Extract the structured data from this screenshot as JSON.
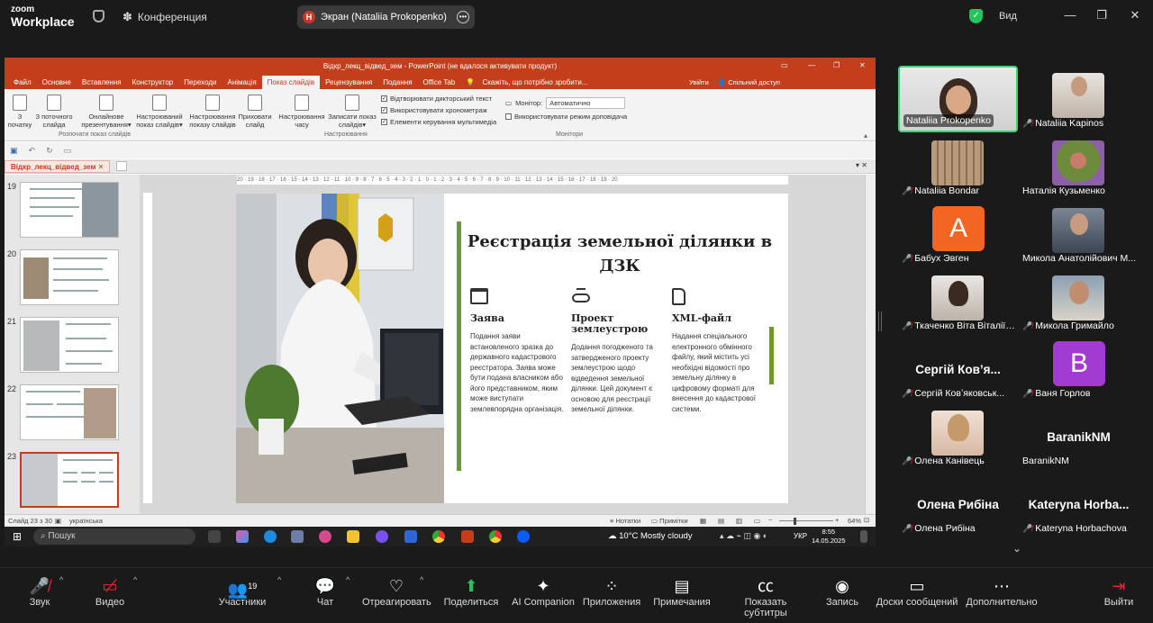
{
  "zoom": {
    "logo_top": "zoom",
    "logo_bottom": "Workplace",
    "meeting_label": "Конференция",
    "share_label": "Экран (Nataliia Prokopenko)",
    "share_initial": "H",
    "view_label": "Вид",
    "accent_green": "#22c55e"
  },
  "ppt": {
    "title_bar": "Відкр_лекц_відвед_зем - PowerPoint (не вдалося активувати продукт)",
    "tabs": [
      "Файл",
      "Основне",
      "Вставлення",
      "Конструктор",
      "Переходи",
      "Анімація",
      "Показ слайдів",
      "Рецензування",
      "Подання",
      "Office Tab"
    ],
    "active_tab": "Показ слайдів",
    "tell_me": "Скажіть, що потрібно зробити...",
    "sign_in": "Увійти",
    "share": "Спільний доступ",
    "ribbon_buttons": [
      {
        "line1": "З",
        "line2": "початку"
      },
      {
        "line1": "З поточного",
        "line2": "слайда"
      },
      {
        "line1": "Онлайнове",
        "line2": "презентування"
      },
      {
        "line1": "Настроюваний",
        "line2": "показ слайдів"
      },
      {
        "line1": "Настроювання",
        "line2": "показу слайдів"
      },
      {
        "line1": "Приховати",
        "line2": "слайд"
      },
      {
        "line1": "Настроювання",
        "line2": "часу"
      },
      {
        "line1": "Записати показ",
        "line2": "слайдів"
      }
    ],
    "checkboxes": [
      "Відтворювати дикторський текст",
      "Використовувати хронометраж",
      "Елементи керування мультимедіа"
    ],
    "group_start": "Розпочати показ слайдів",
    "group_setup": "Настроювання",
    "group_monitors": "Монітори",
    "monitor_label": "Монітор:",
    "monitor_value": "Автоматично",
    "presenter_view": "Використовувати режим доповідача",
    "doc_tab": "Відкр_лекц_відвед_зем",
    "ruler": "20 · 19 · 18 · 17 · 16 · 15 · 14 · 13 · 12 · 11 · 10 · 9 · 8 · 7 · 6 · 5 · 4 · 3 · 2 · 1 · 0 · 1 · 2 · 3 · 4 · 5 · 6 · 7 · 8 · 9 · 10 · 11 · 12 · 13 · 14 · 15 · 16 · 17 · 18 · 19 · 20",
    "thumbnails": [
      {
        "num": "19",
        "title": "Експертиза проекту землеустрою"
      },
      {
        "num": "20",
        "title": "Погодження проекту землеустрою"
      },
      {
        "num": "21",
        "title": "Рішення територіальної громади"
      },
      {
        "num": "22",
        "title": "Державна реєстрація земельної ділянки"
      },
      {
        "num": "23",
        "title": "Реєстрація земельної ділянки в ДЗК"
      }
    ],
    "status_slide": "Слайд 23 з 30",
    "status_lang": "українська",
    "status_notes": "Нотатки",
    "status_comments": "Примітки",
    "zoom_pct": "64%",
    "accent": "#c43e1c"
  },
  "slide": {
    "title": "Реєстрація земельної ділянки в ДЗК",
    "columns": [
      {
        "icon": "browser-icon",
        "heading": "Заява",
        "text": "Подання заяви встановленого зразка до державного кадастрового реєстратора. Заява може бути подана власником або його представником, яким може виступати землевпорядна організація."
      },
      {
        "icon": "survey-icon",
        "heading": "Проект землеустрою",
        "text": "Додання погодженого та затвердженого проекту землеустрою щодо відведення земельної ділянки. Цей документ є основою для реєстрації земельної ділянки."
      },
      {
        "icon": "file-icon",
        "heading": "XML-файл",
        "text": "Надання спеціального електронного обмінного файлу, який містить усі необхідні відомості про земельну ділянку в цифровому форматі для внесення до кадастрової системи."
      }
    ],
    "accent_green": "#6a9a2e"
  },
  "windows_taskbar": {
    "search": "Пошук",
    "weather": "10°C  Mostly cloudy",
    "lang": "УКР",
    "time": "8:55",
    "date": "14.05.2025"
  },
  "participants": [
    {
      "name": "Nataliia Prokopenko",
      "muted": false,
      "speaking": true,
      "type": "video"
    },
    {
      "name": "Nataliia Kapinos",
      "muted": true,
      "type": "video"
    },
    {
      "name": "Nataliia Bondar",
      "muted": true,
      "type": "video"
    },
    {
      "name": "Наталія Кузьменко",
      "muted": false,
      "type": "video"
    },
    {
      "name": "Бабух Эвген",
      "muted": true,
      "type": "letter",
      "letter": "A",
      "color": "#f26522"
    },
    {
      "name": "Микола Анатолійович М...",
      "muted": false,
      "type": "video"
    },
    {
      "name": "Ткаченко Віта Віталіїв...",
      "muted": true,
      "type": "video"
    },
    {
      "name": "Микола Гримайло",
      "muted": true,
      "type": "video"
    },
    {
      "name": "Сергій Ковʼяковськ...",
      "muted": true,
      "type": "text",
      "big": "Сергій Ков’я..."
    },
    {
      "name": "Ваня Горлов",
      "muted": true,
      "type": "letter",
      "letter": "B",
      "color": "#a23bd1"
    },
    {
      "name": "Олена Канівець",
      "muted": true,
      "type": "video"
    },
    {
      "name": "BaranikNM",
      "muted": false,
      "type": "text",
      "big": "BaranikNM"
    },
    {
      "name": "Олена Рибіна",
      "muted": true,
      "type": "text",
      "big": "Олена Рибіна"
    },
    {
      "name": "Kateryna Horbachova",
      "muted": true,
      "type": "text",
      "big": "Kateryna Horba..."
    }
  ],
  "toolbar": {
    "items": [
      {
        "label": "Звук",
        "icon": "mic-muted-icon"
      },
      {
        "label": "Видео",
        "icon": "video-off-icon"
      },
      {
        "label": "Участники",
        "icon": "participants-icon",
        "count": "19"
      },
      {
        "label": "Чат",
        "icon": "chat-icon"
      },
      {
        "label": "Отреагировать",
        "icon": "heart-icon"
      },
      {
        "label": "Поделиться",
        "icon": "share-icon"
      },
      {
        "label": "AI Companion",
        "icon": "sparkle-icon"
      },
      {
        "label": "Приложения",
        "icon": "apps-icon"
      },
      {
        "label": "Примечания",
        "icon": "notes-icon"
      },
      {
        "label": "Показать субтитры",
        "icon": "cc-icon"
      },
      {
        "label": "Запись",
        "icon": "record-icon"
      },
      {
        "label": "Доски сообщений",
        "icon": "whiteboard-icon"
      },
      {
        "label": "Дополнительно",
        "icon": "more-icon"
      },
      {
        "label": "Выйти",
        "icon": "leave-icon"
      }
    ]
  }
}
